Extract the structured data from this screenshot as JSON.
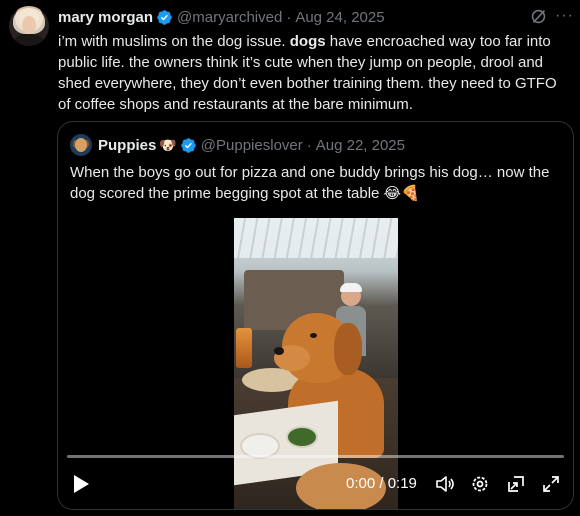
{
  "post": {
    "author_name": "mary morgan",
    "author_handle": "@maryarchived",
    "separator": "·",
    "date": "Aug 24, 2025",
    "text_before": "i’m with muslims on the dog issue. ",
    "text_bold": "dogs",
    "text_after": " have encroached way too far into public life. the owners think it’s cute when they jump on people, drool and shed everywhere, they don’t even bother training them. they need to GTFO of coffee shops and restaurants at the bare minimum.",
    "more_glyph": "···"
  },
  "quote": {
    "author_name": "Puppies",
    "name_emoji": "🐶",
    "author_handle": "@Puppieslover",
    "separator": "·",
    "date": "Aug 22, 2025",
    "text": "When the boys go out for pizza and one buddy brings his dog… now the dog scored the prime begging spot at the table 😂🍕"
  },
  "video": {
    "time_display": "0:00 / 0:19",
    "progress": 0
  },
  "colors": {
    "background": "#000000",
    "text_primary": "#e7e9ea",
    "text_secondary": "#71767b",
    "verified_blue": "#1d9bf0",
    "border": "#2f3336"
  },
  "icons": [
    "verified-badge-icon",
    "grok-icon",
    "more-icon",
    "play-icon",
    "volume-icon",
    "settings-icon",
    "picture-in-picture-icon",
    "fullscreen-icon"
  ]
}
